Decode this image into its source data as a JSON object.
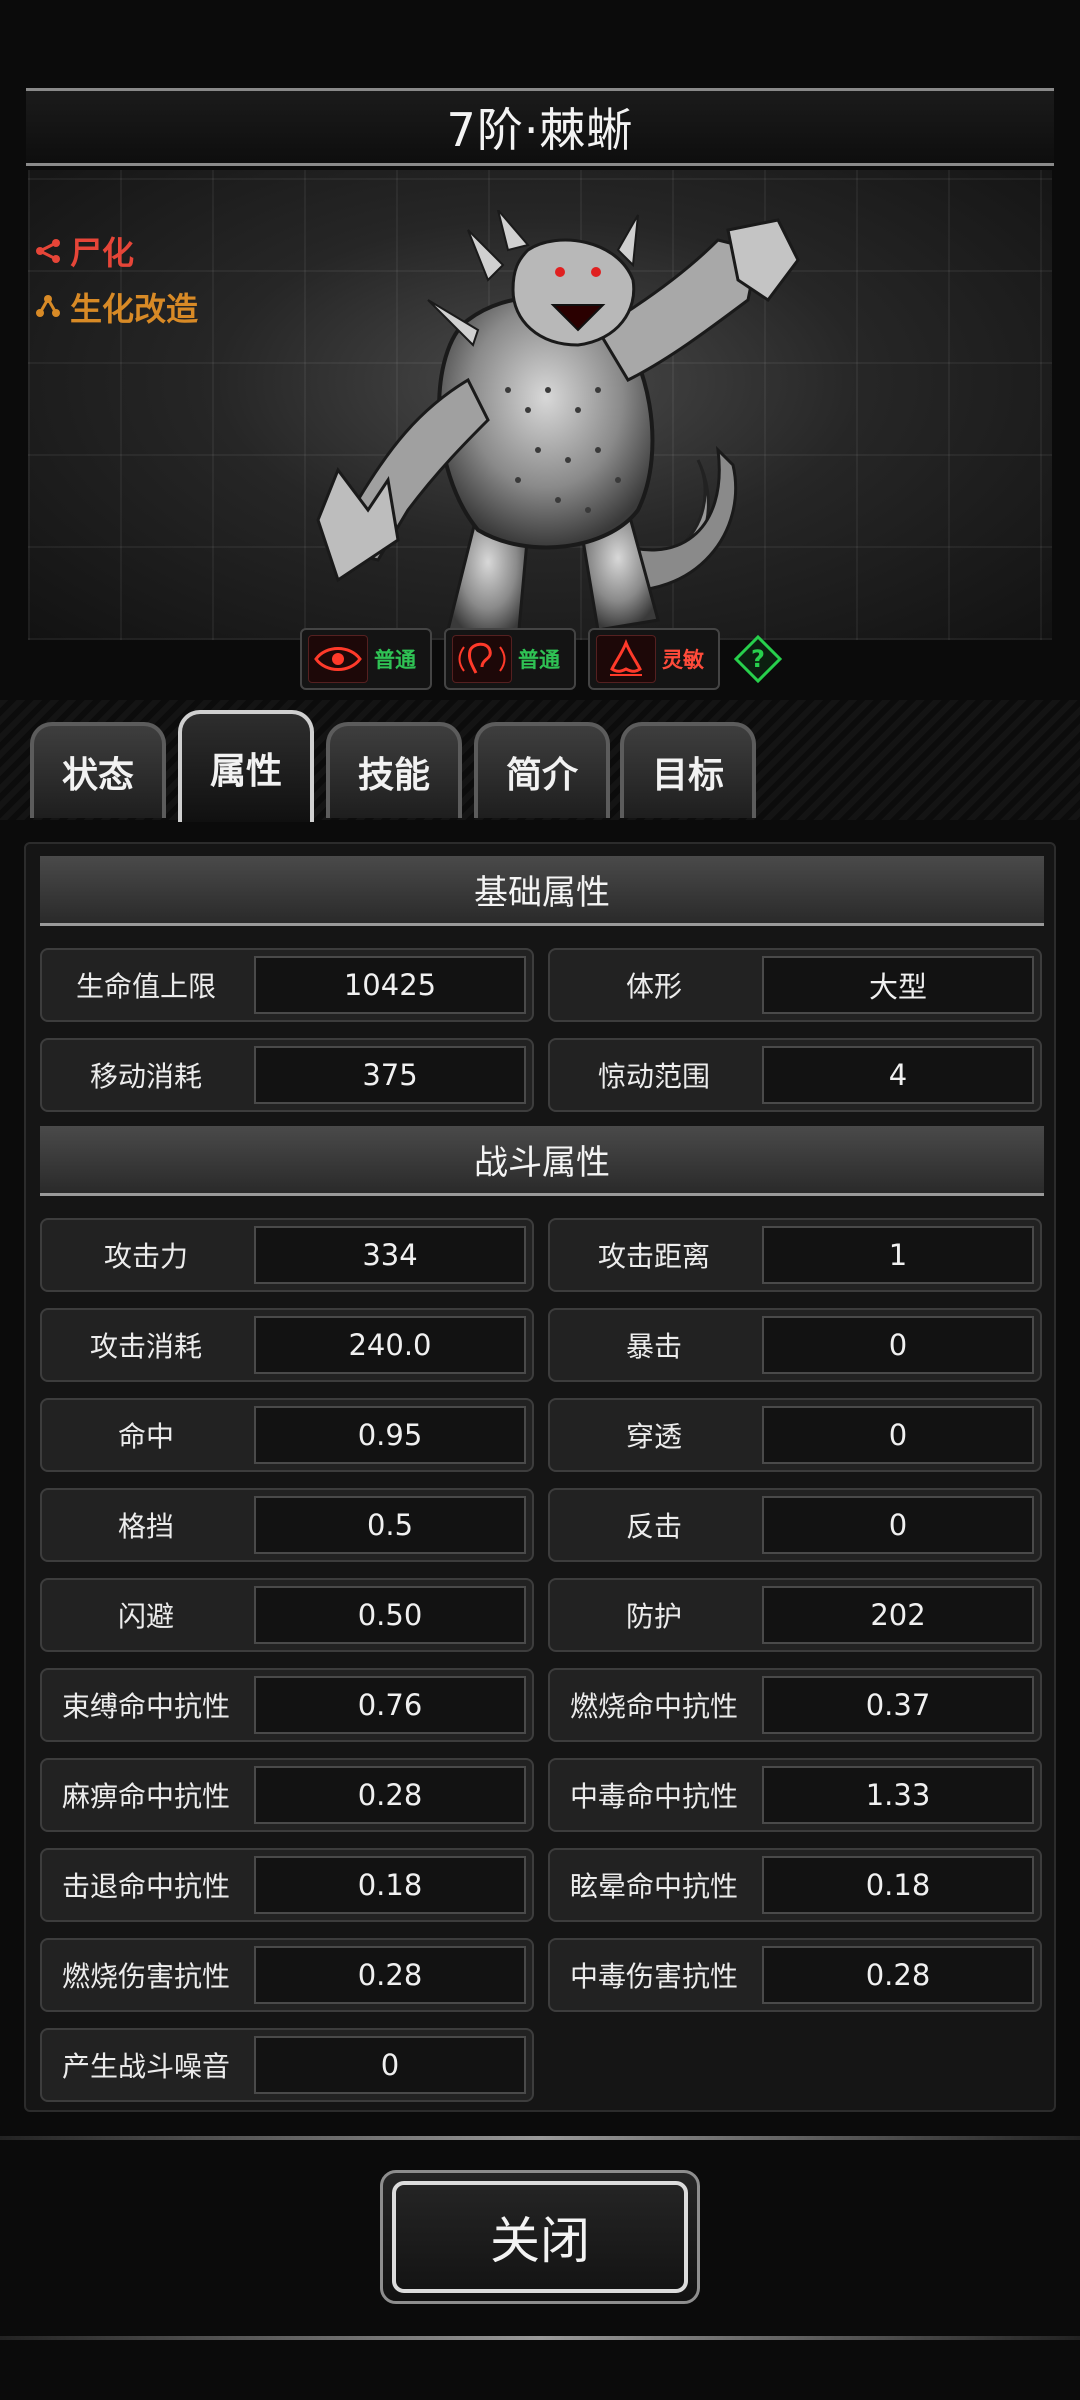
{
  "title": "7阶·棘蜥",
  "tags": [
    {
      "label": "尸化",
      "color": "#e64538",
      "icon": "share-node-icon"
    },
    {
      "label": "生化改造",
      "color": "#d88a26",
      "icon": "branch-node-icon"
    }
  ],
  "senses": [
    {
      "icon": "eye-icon",
      "label": "普通",
      "color": "#2fc254"
    },
    {
      "icon": "ear-icon",
      "label": "普通",
      "color": "#2fc254"
    },
    {
      "icon": "nose-icon",
      "label": "灵敏",
      "color": "#ff4b3a"
    }
  ],
  "help_label": "?",
  "tabs": [
    {
      "label": "状态",
      "active": false
    },
    {
      "label": "属性",
      "active": true
    },
    {
      "label": "技能",
      "active": false
    },
    {
      "label": "简介",
      "active": false
    },
    {
      "label": "目标",
      "active": false
    }
  ],
  "sections": {
    "basic": "基础属性",
    "combat": "战斗属性"
  },
  "basic_stats": [
    {
      "label": "生命值上限",
      "value": "10425"
    },
    {
      "label": "体形",
      "value": "大型"
    },
    {
      "label": "移动消耗",
      "value": "375"
    },
    {
      "label": "惊动范围",
      "value": "4"
    }
  ],
  "combat_stats": [
    {
      "label": "攻击力",
      "value": "334"
    },
    {
      "label": "攻击距离",
      "value": "1"
    },
    {
      "label": "攻击消耗",
      "value": "240.0"
    },
    {
      "label": "暴击",
      "value": "0"
    },
    {
      "label": "命中",
      "value": "0.95"
    },
    {
      "label": "穿透",
      "value": "0"
    },
    {
      "label": "格挡",
      "value": "0.5"
    },
    {
      "label": "反击",
      "value": "0"
    },
    {
      "label": "闪避",
      "value": "0.50"
    },
    {
      "label": "防护",
      "value": "202"
    },
    {
      "label": "束缚命中抗性",
      "value": "0.76"
    },
    {
      "label": "燃烧命中抗性",
      "value": "0.37"
    },
    {
      "label": "麻痹命中抗性",
      "value": "0.28"
    },
    {
      "label": "中毒命中抗性",
      "value": "1.33"
    },
    {
      "label": "击退命中抗性",
      "value": "0.18"
    },
    {
      "label": "眩晕命中抗性",
      "value": "0.18"
    },
    {
      "label": "燃烧伤害抗性",
      "value": "0.28"
    },
    {
      "label": "中毒伤害抗性",
      "value": "0.28"
    },
    {
      "label": "产生战斗噪音",
      "value": "0"
    }
  ],
  "close_label": "关闭"
}
